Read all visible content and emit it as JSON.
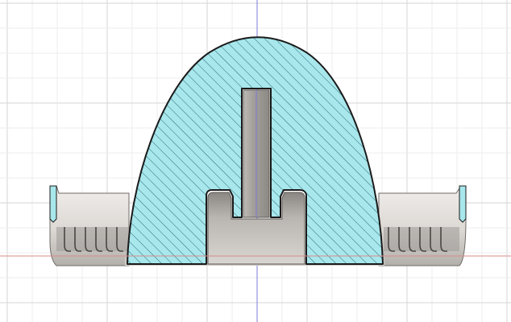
{
  "viewport": {
    "view": "section-analysis",
    "colors": {
      "background": "#ffffff",
      "grid_minor": "#ececec",
      "grid_major": "#d6d6d6",
      "axis_vertical": "#7b7bd8",
      "axis_horizontal": "#d98b8b",
      "section_fill": "#a8e7ec",
      "hatch": "#1d5f6a",
      "outline": "#1b1b1b",
      "body_light": "#e6e2de",
      "body_dark": "#8d8985"
    }
  }
}
